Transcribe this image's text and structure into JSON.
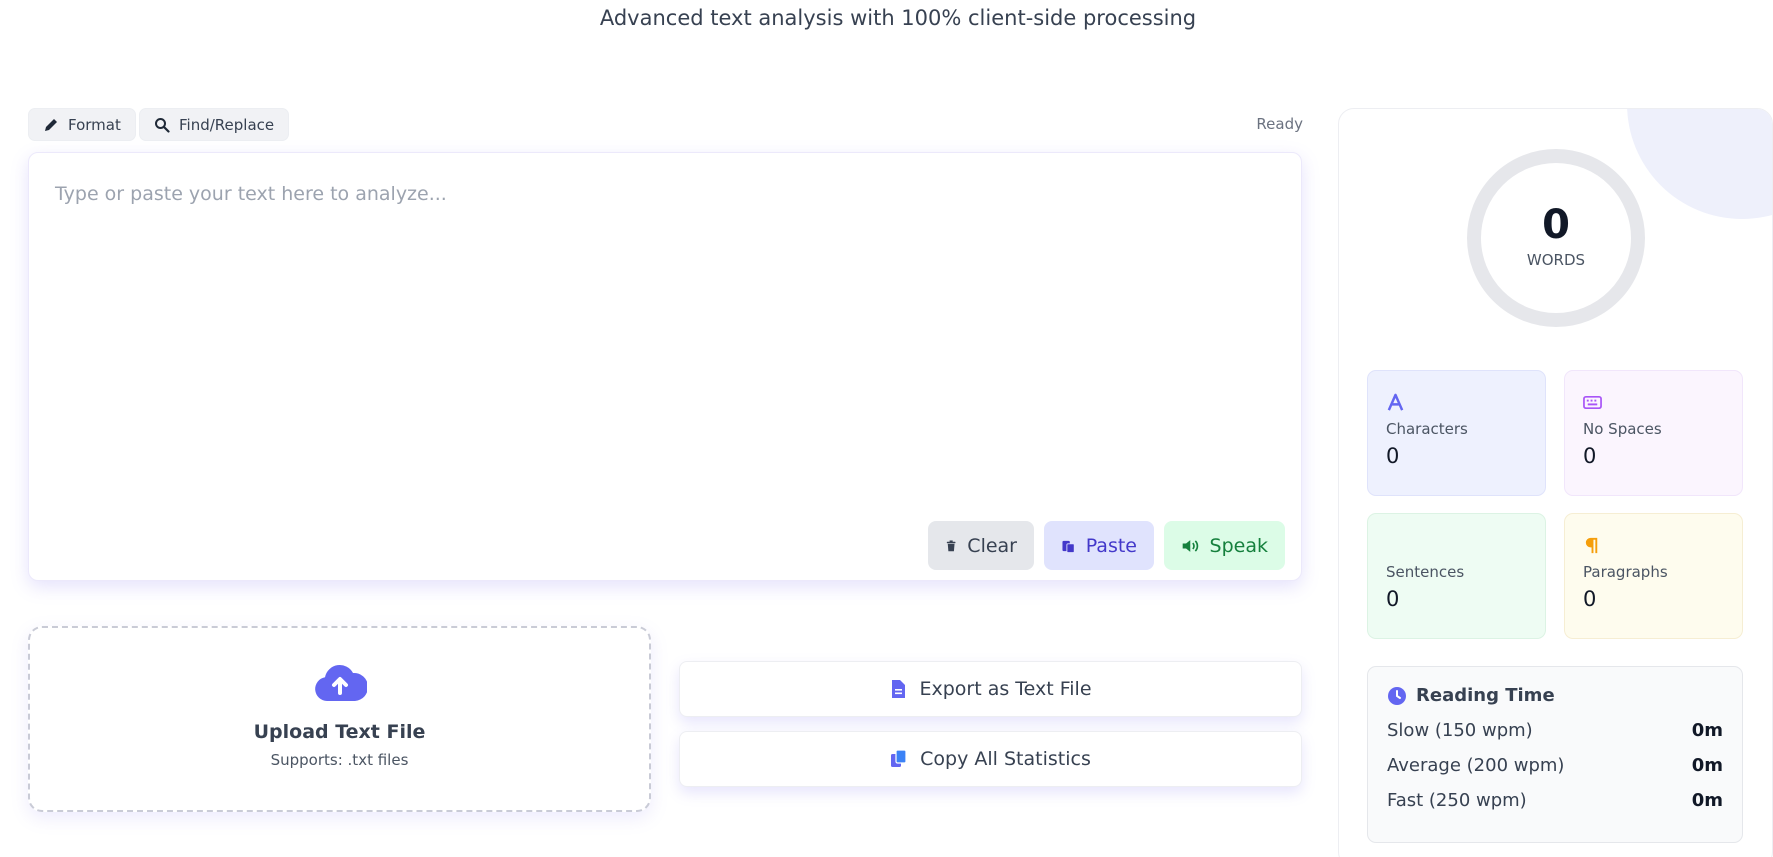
{
  "header": {
    "subtitle": "Advanced text analysis with 100% client-side processing"
  },
  "toolbar": {
    "format_label": "Format",
    "find_replace_label": "Find/Replace",
    "status": "Ready"
  },
  "editor": {
    "placeholder": "Type or paste your text here to analyze...",
    "clear_label": "Clear",
    "paste_label": "Paste",
    "speak_label": "Speak"
  },
  "upload": {
    "title": "Upload Text File",
    "subtitle": "Supports: .txt files"
  },
  "actions": {
    "export_label": "Export as Text File",
    "copy_label": "Copy All Statistics"
  },
  "stats": {
    "words_value": "0",
    "words_label": "WORDS",
    "characters_label": "Characters",
    "characters_value": "0",
    "no_spaces_label": "No Spaces",
    "no_spaces_value": "0",
    "sentences_label": "Sentences",
    "sentences_value": "0",
    "paragraphs_label": "Paragraphs",
    "paragraphs_value": "0"
  },
  "reading_time": {
    "title": "Reading Time",
    "rows": [
      {
        "label": "Slow (150 wpm)",
        "value": "0m"
      },
      {
        "label": "Average (200 wpm)",
        "value": "0m"
      },
      {
        "label": "Fast (250 wpm)",
        "value": "0m"
      }
    ]
  },
  "colors": {
    "accent": "#6366f1",
    "characters_icon": "#6366f1",
    "no_spaces_icon": "#a855f7",
    "paragraphs_icon": "#f59e0b",
    "speak": "#15803d"
  },
  "icons": {
    "format": "pencil-icon",
    "find_replace": "search-icon",
    "clear": "trash-icon",
    "paste": "paste-icon",
    "speak": "speaker-icon",
    "upload": "cloud-upload-icon",
    "export": "file-icon",
    "copy": "copy-icon",
    "characters": "font-icon",
    "no_spaces": "keyboard-icon",
    "paragraphs": "pilcrow-icon",
    "reading_time": "clock-icon"
  }
}
